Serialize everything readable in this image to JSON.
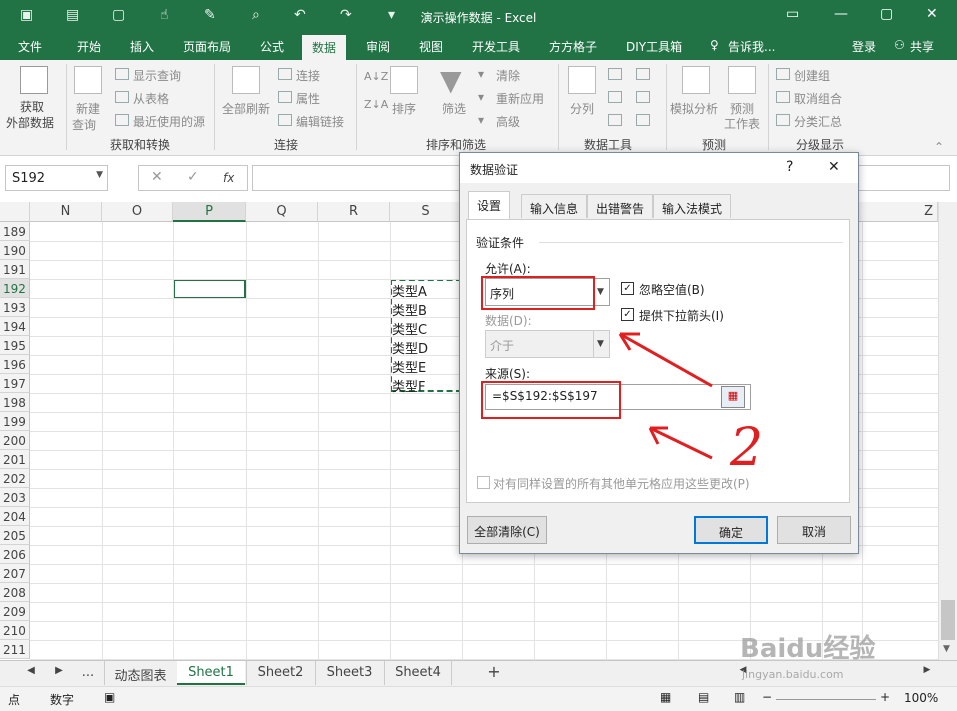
{
  "window": {
    "title": "演示操作数据 - Excel"
  },
  "menu": {
    "tabs": [
      "文件",
      "开始",
      "插入",
      "页面布局",
      "公式",
      "数据",
      "审阅",
      "视图",
      "开发工具",
      "方方格子",
      "DIY工具箱"
    ],
    "tell": "告诉我...",
    "login": "登录",
    "share": "共享"
  },
  "ribbon": {
    "get_data": "获取",
    "ext_data": "外部数据",
    "new_query": "新建",
    "query": "查询",
    "show_query": "显示查询",
    "from_table": "从表格",
    "recent": "最近使用的源",
    "refresh_all": "全部刷新",
    "conn": "连接",
    "props": "属性",
    "edit_links": "编辑链接",
    "sort": "排序",
    "filter": "筛选",
    "clear": "清除",
    "reapply": "重新应用",
    "advanced": "高级",
    "split": "分列",
    "whatif": "模拟分析",
    "forecast": "预测",
    "sheet": "工作表",
    "group": "创建组",
    "ungroup": "取消组合",
    "subtotal": "分类汇总",
    "groups": [
      "获取和转换",
      "连接",
      "排序和筛选",
      "数据工具",
      "预测",
      "分级显示"
    ]
  },
  "formula": {
    "namebox": "S192",
    "fx": "fx"
  },
  "columns": [
    "N",
    "O",
    "P",
    "Q",
    "R",
    "S",
    "Z"
  ],
  "rows": [
    "189",
    "190",
    "191",
    "192",
    "193",
    "194",
    "195",
    "196",
    "197",
    "198",
    "199",
    "200",
    "201",
    "202",
    "203",
    "204",
    "205",
    "206",
    "207",
    "208",
    "209",
    "210",
    "211"
  ],
  "cells": [
    "类型A",
    "类型B",
    "类型C",
    "类型D",
    "类型E",
    "类型F"
  ],
  "sheets": {
    "more": "...",
    "tabs": [
      "动态图表",
      "Sheet1",
      "Sheet2",
      "Sheet3",
      "Sheet4"
    ],
    "add": "+"
  },
  "status": {
    "mode": "点",
    "num": "数字",
    "zoom": "100%"
  },
  "dialog": {
    "title": "数据验证",
    "help": "?",
    "close": "✕",
    "tabs": [
      "设置",
      "输入信息",
      "出错警告",
      "输入法模式"
    ],
    "criteria": "验证条件",
    "allow_label": "允许(A):",
    "allow_value": "序列",
    "ignore_blank": "忽略空值(B)",
    "dropdown": "提供下拉箭头(I)",
    "data_label": "数据(D):",
    "data_value": "介于",
    "source_label": "来源(S):",
    "source_value": "=$S$192:$S$197",
    "apply_all": "对有同样设置的所有其他单元格应用这些更改(P)",
    "clear_all": "全部清除(C)",
    "ok": "确定",
    "cancel": "取消"
  },
  "annotation": {
    "number": "2",
    "color": "#e02020"
  },
  "watermark": {
    "text": "Baidu经验",
    "url": "jingyan.baidu.com"
  }
}
